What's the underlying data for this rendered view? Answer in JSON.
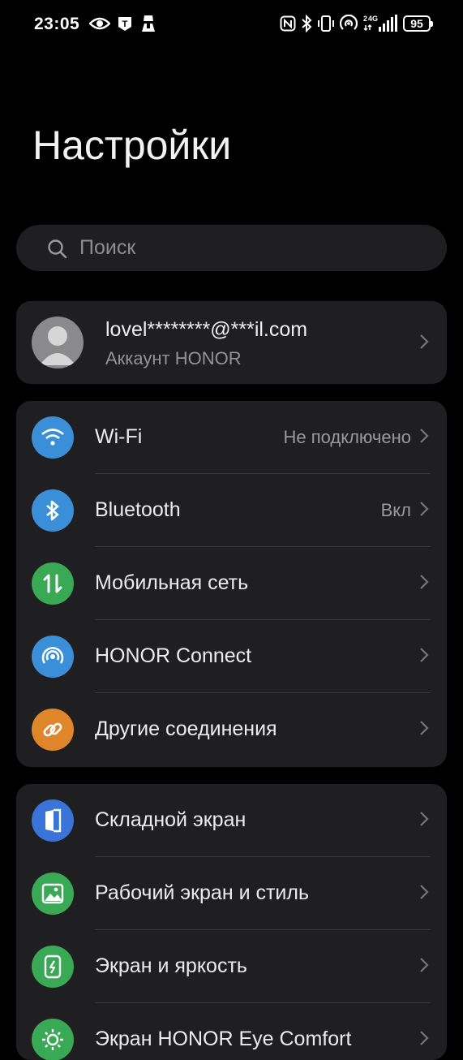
{
  "status_bar": {
    "time": "23:05",
    "battery": "95",
    "network": "4G",
    "left_icons": [
      "eye-icon",
      "tiktok-icon",
      "incognito-icon"
    ],
    "right_icons": [
      "nfc-icon",
      "bluetooth-icon",
      "vibrate-icon",
      "hotspot-icon",
      "signal-icon",
      "battery-icon"
    ]
  },
  "title": "Настройки",
  "search": {
    "placeholder": "Поиск"
  },
  "account": {
    "email": "lovel********@***il.com",
    "subtitle": "Аккаунт HONOR"
  },
  "groups": [
    {
      "items": [
        {
          "label": "Wi-Fi",
          "value": "Не подключено",
          "icon": "wifi-icon",
          "color": "#3b8fd9"
        },
        {
          "label": "Bluetooth",
          "value": "Вкл",
          "icon": "bluetooth-icon",
          "color": "#3b8fd9"
        },
        {
          "label": "Мобильная сеть",
          "value": "",
          "icon": "mobile-data-icon",
          "color": "#3aa955"
        },
        {
          "label": "HONOR Connect",
          "value": "",
          "icon": "honor-connect-icon",
          "color": "#3b8fd9"
        },
        {
          "label": "Другие соединения",
          "value": "",
          "icon": "link-icon",
          "color": "#e0862a"
        }
      ]
    },
    {
      "items": [
        {
          "label": "Складной экран",
          "value": "",
          "icon": "fold-screen-icon",
          "color": "#3a73d9"
        },
        {
          "label": "Рабочий экран и стиль",
          "value": "",
          "icon": "wallpaper-icon",
          "color": "#3aa955"
        },
        {
          "label": "Экран и яркость",
          "value": "",
          "icon": "brightness-icon",
          "color": "#3aa955"
        },
        {
          "label": "Экран HONOR Eye Comfort",
          "value": "",
          "icon": "eye-comfort-icon",
          "color": "#3aa955"
        }
      ]
    }
  ]
}
